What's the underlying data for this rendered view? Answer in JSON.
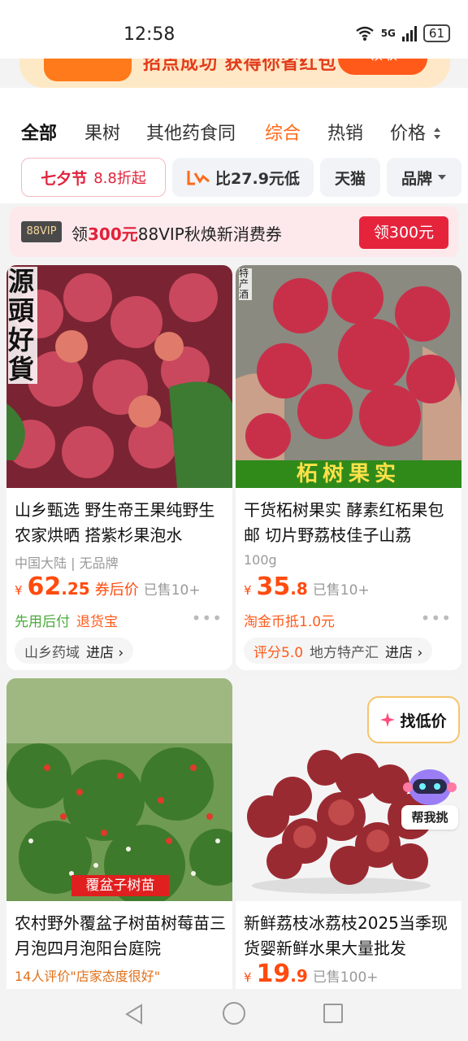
{
  "status_bar": {
    "time": "12:58",
    "network": "5G",
    "battery": "61"
  },
  "promo_strip": {
    "text": "招点成功 获得你省红包",
    "button": "领取"
  },
  "tabs": [
    {
      "label": "全部",
      "active": true
    },
    {
      "label": "果树"
    },
    {
      "label": "其他药食同"
    },
    {
      "label": "综合",
      "highlight": true
    },
    {
      "label": "热销"
    },
    {
      "label": "价格"
    }
  ],
  "filters": {
    "festival": {
      "label": "七夕节",
      "sub": "8.8折起"
    },
    "compare": {
      "label": "比27.9元低"
    },
    "tmall": {
      "label": "天猫"
    },
    "brand": {
      "label": "品牌"
    }
  },
  "vip_bar": {
    "badge": "88VIP",
    "text_prefix": "领",
    "amount": "300元",
    "text_suffix": "88VIP秋焕新消费券",
    "button": "领300元"
  },
  "products": [
    {
      "title": "山乡甄选 野生帝王果纯野生农家烘晒 搭紫杉果泡水",
      "meta": "中国大陆 | 无品牌",
      "price_currency": "¥",
      "price_int": "62",
      "price_dec": ".25",
      "price_tag": "券后价",
      "sold": "已售10+",
      "line2_green": "先用后付",
      "line2_orange": "退货宝",
      "store_score": "",
      "store_name": "山乡药域",
      "store_go": "进店 ›",
      "image_overlay_text": "源頭好貨"
    },
    {
      "title": "干货柘树果实 酵素红柘果包邮 切片野荔枝佳子山荔",
      "meta": "100g",
      "price_currency": "¥",
      "price_int": "35",
      "price_dec": ".8",
      "price_tag": "",
      "sold": "已售10+",
      "line2_green": "",
      "line2_orange": "淘金币抵1.0元",
      "store_score": "评分5.0",
      "store_name": "地方特产汇",
      "store_go": "进店 ›",
      "image_overlay_text": "柘树果实",
      "image_corner_text": "特产酒"
    },
    {
      "title": "农村野外覆盆子树苗树莓苗三月泡四月泡阳台庭院",
      "meta": "14人评价\"店家态度很好\"",
      "image_overlay_text": "覆盆子树苗"
    },
    {
      "title": "新鲜荔枝冰荔枝2025当季现货婴新鲜水果大量批发",
      "price_currency": "¥",
      "price_int": "19",
      "price_dec": ".9",
      "sold": "已售100+"
    }
  ],
  "floating": {
    "find_low": "找低价",
    "help_pick": "帮我挑"
  },
  "colors": {
    "accent": "#ff6a1a",
    "price": "#ff4b0f",
    "red": "#e5243c",
    "green": "#4caa3c"
  }
}
